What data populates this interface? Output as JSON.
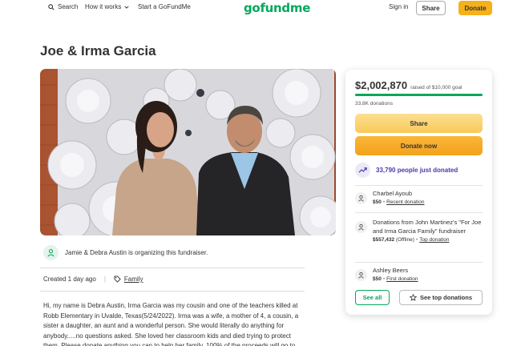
{
  "header": {
    "search_label": "Search",
    "how_label": "How it works",
    "start_label": "Start a GoFundMe",
    "logo_text": "gofundme",
    "signin_label": "Sign in",
    "share_label": "Share",
    "donate_label": "Donate"
  },
  "campaign": {
    "title": "Joe & Irma Garcia",
    "organizer_text": "Jamie & Debra Austin is organizing this fundraiser.",
    "created": "Created 1 day ago",
    "category": "Family",
    "story": "Hi, my name is Debra Austin, Irma Garcia was my cousin and one of the teachers killed at Robb Elementary in Uvalde, Texas(5/24/2022). Irma was a wife, a mother of 4, a cousin, a sister a daughter, an aunt and a wonderful person. She would literally do anything for anybody.....no questions asked. She loved her classroom kids and died trying to protect them. Please donate anything you can to help her family. 100% of the proceeds will go to"
  },
  "card": {
    "amount": "$2,002,870",
    "goal": "raised of $10,000 goal",
    "progress_fraction": 1.0,
    "donations": "33.8K donations",
    "share_label": "Share",
    "donate_label": "Donate now",
    "trend_text": "33,790 people just donated",
    "donors": [
      {
        "name": "Charbel Ayoub",
        "amount": "$50",
        "note": "Recent donation"
      },
      {
        "name": "Donations from John Martinez's \"For Joe and Irma Garcia Family\" fundraiser",
        "amount": "$557,432",
        "status": "(Offline)",
        "note": "Top donation"
      },
      {
        "name": "Ashley Beers",
        "amount": "$50",
        "note": "First donation"
      }
    ],
    "see_all_label": "See all",
    "see_top_label": "See top donations"
  },
  "colors": {
    "brand_green": "#02a95c",
    "donate_orange": "#f6b01a",
    "trend_purple": "#4b3aa8"
  }
}
